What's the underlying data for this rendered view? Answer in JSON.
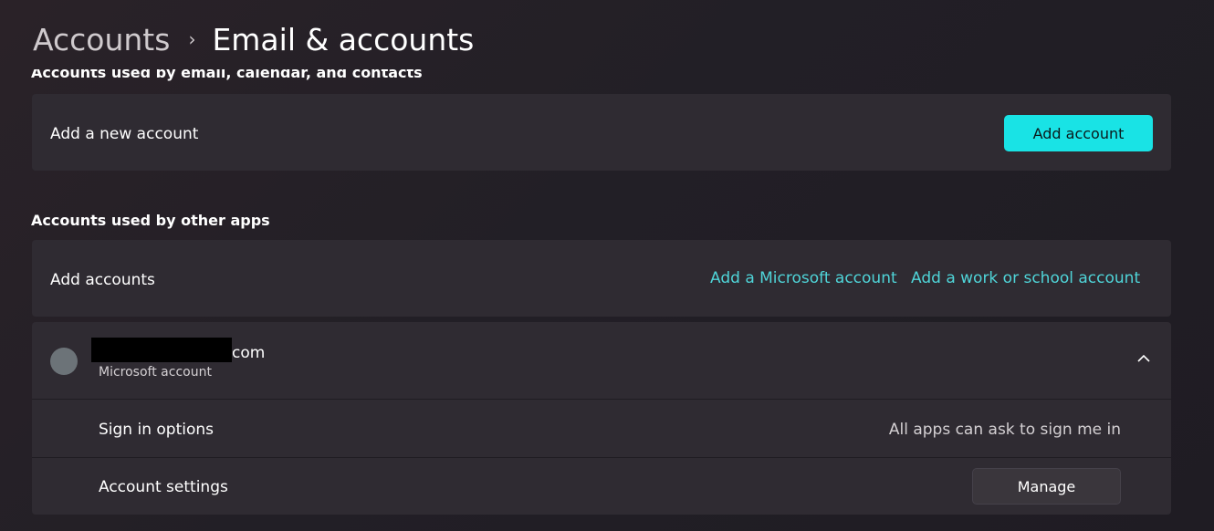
{
  "header": {
    "parent": "Accounts",
    "separator": "›",
    "current": "Email & accounts"
  },
  "email_section": {
    "heading": "Accounts used by email, calendar, and contacts",
    "row_label": "Add a new account",
    "button_label": "Add account"
  },
  "other_apps_section": {
    "heading": "Accounts used by other apps",
    "row_label": "Add accounts",
    "link_microsoft": "Add a Microsoft account",
    "link_work": "Add a work or school account"
  },
  "account": {
    "email_suffix": "com",
    "type": "Microsoft account",
    "sign_in_label": "Sign in options",
    "sign_in_value": "All apps can ask to sign me in",
    "settings_label": "Account settings",
    "manage_label": "Manage"
  },
  "colors": {
    "accent": "#19e3e5",
    "link": "#4fd4d8",
    "card": "#2f2b32"
  },
  "icons": {
    "breadcrumb": "chevron-right-icon",
    "expander": "chevron-up-icon",
    "avatar": "avatar"
  }
}
